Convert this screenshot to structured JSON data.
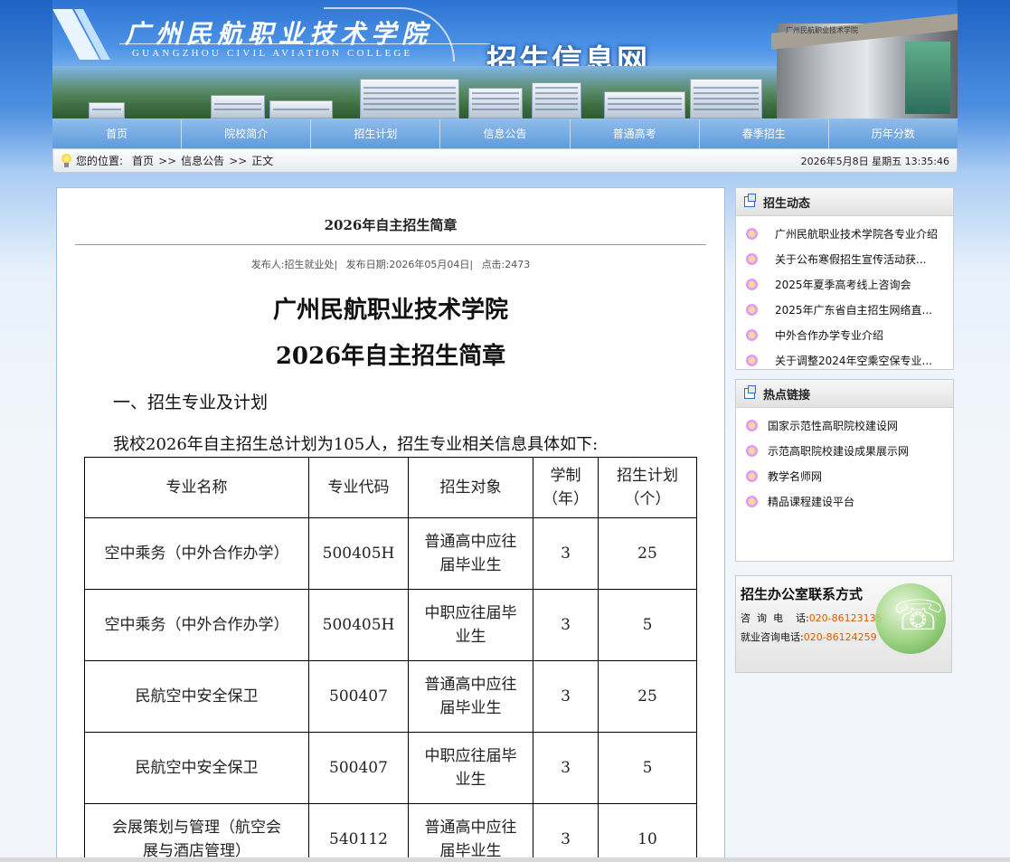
{
  "header": {
    "college_cn": "广州民航职业技术学院",
    "college_en": "GUANGZHOU CIVIL AVIATION COLLEGE",
    "site_title": "招生信息网",
    "gate_label": "广州民航职业技术学院"
  },
  "nav": {
    "items": [
      "首页",
      "院校简介",
      "招生计划",
      "信息公告",
      "普通高考",
      "春季招生",
      "历年分数"
    ]
  },
  "location": {
    "label": "您的位置:",
    "crumbs": [
      "首页",
      "信息公告",
      "正文"
    ],
    "separator": ">>",
    "datetime": "2026年5月8日  星期五  13:35:46"
  },
  "article": {
    "title": "2026年自主招生简章",
    "publisher": "发布人:招生就业处|",
    "date": "发布日期:2026年05月04日|",
    "clicks": "点击:2473",
    "heading_line1": "广州民航职业技术学院",
    "heading_line2": "2026年自主招生简章",
    "section1": "一、招生专业及计划",
    "intro": "我校2026年自主招生总计划为105人，招生专业相关信息具体如下:",
    "table": {
      "headers": [
        "专业名称",
        "专业代码",
        "招生对象",
        "学制（年）",
        "招生计划（个）"
      ],
      "rows": [
        [
          "空中乘务（中外合作办学）",
          "500405H",
          "普通高中应往届毕业生",
          "3",
          "25"
        ],
        [
          "空中乘务（中外合作办学）",
          "500405H",
          "中职应往届毕业生",
          "3",
          "5"
        ],
        [
          "民航空中安全保卫",
          "500407",
          "普通高中应往届毕业生",
          "3",
          "25"
        ],
        [
          "民航空中安全保卫",
          "500407",
          "中职应往届毕业生",
          "3",
          "5"
        ],
        [
          "会展策划与管理（航空会展与酒店管理）",
          "540112",
          "普通高中应往届毕业生",
          "3",
          "10"
        ]
      ]
    }
  },
  "sidebar": {
    "news": {
      "title": "招生动态",
      "items": [
        "广州民航职业技术学院各专业介绍",
        "关于公布寒假招生宣传活动获...",
        "2025年夏季高考线上咨询会",
        "2025年广东省自主招生网络直...",
        "中外合作办学专业介绍",
        "关于调整2024年空乘空保专业..."
      ]
    },
    "links": {
      "title": "热点链接",
      "items": [
        "国家示范性高职院校建设网",
        "示范高职院校建设成果展示网",
        "教学名师网",
        "精品课程建设平台"
      ]
    },
    "contact": {
      "title": "招生办公室联系方式",
      "phone_label": "咨  询  电    话:",
      "phone": "020-86123135",
      "job_label": "就业咨询电话:",
      "job_phone": "020-86124259"
    }
  },
  "colors": {
    "nav_bg": "#6fa8e4",
    "border": "#9fc1e6",
    "phone_accent": "#e05b00"
  }
}
